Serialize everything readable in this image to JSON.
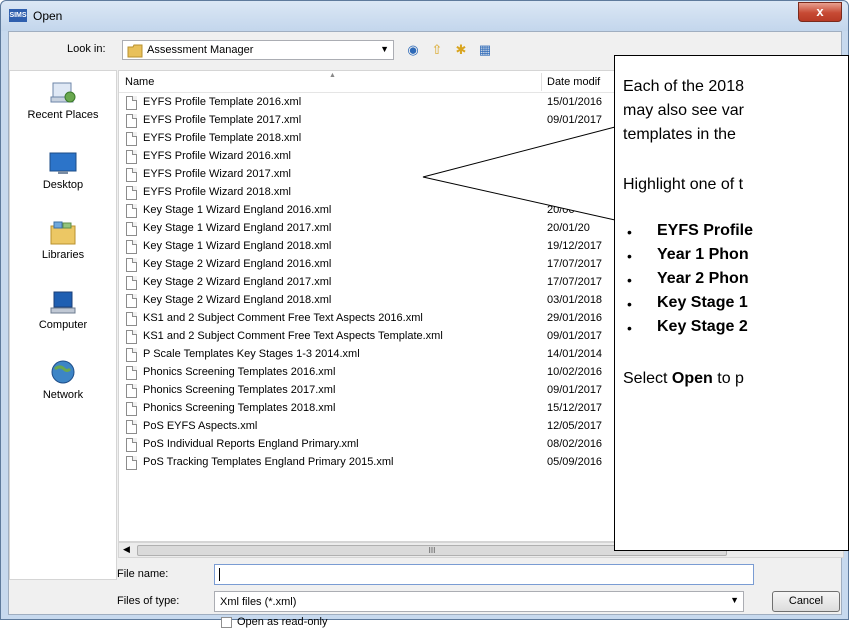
{
  "window": {
    "title": "Open",
    "app_badge": "SIMS",
    "close_glyph": "x"
  },
  "toolbar": {
    "look_in_label": "Look in:",
    "look_in_value": "Assessment Manager"
  },
  "places": [
    {
      "label": "Recent Places"
    },
    {
      "label": "Desktop"
    },
    {
      "label": "Libraries"
    },
    {
      "label": "Computer"
    },
    {
      "label": "Network"
    }
  ],
  "list": {
    "headers": {
      "name": "Name",
      "date": "Date modif"
    },
    "files": [
      {
        "name": "EYFS Profile Template 2016.xml",
        "date": "15/01/2016"
      },
      {
        "name": "EYFS Profile Template 2017.xml",
        "date": "09/01/2017"
      },
      {
        "name": "EYFS Profile Template 2018.xml",
        "date": ""
      },
      {
        "name": "EYFS Profile Wizard 2016.xml",
        "date": ""
      },
      {
        "name": "EYFS Profile Wizard 2017.xml",
        "date": ""
      },
      {
        "name": "EYFS Profile Wizard 2018.xml",
        "date": "18"
      },
      {
        "name": "Key Stage 1 Wizard England 2016.xml",
        "date": "20/06"
      },
      {
        "name": "Key Stage 1 Wizard England 2017.xml",
        "date": "20/01/20"
      },
      {
        "name": "Key Stage 1 Wizard England 2018.xml",
        "date": "19/12/2017"
      },
      {
        "name": "Key Stage 2 Wizard England 2016.xml",
        "date": "17/07/2017"
      },
      {
        "name": "Key Stage 2 Wizard England 2017.xml",
        "date": "17/07/2017"
      },
      {
        "name": "Key Stage 2 Wizard England 2018.xml",
        "date": "03/01/2018"
      },
      {
        "name": "KS1 and 2 Subject Comment Free Text Aspects 2016.xml",
        "date": "29/01/2016"
      },
      {
        "name": "KS1 and 2 Subject Comment Free Text Aspects Template.xml",
        "date": "09/01/2017"
      },
      {
        "name": "P Scale Templates Key Stages 1-3 2014.xml",
        "date": "14/01/2014"
      },
      {
        "name": "Phonics Screening Templates 2016.xml",
        "date": "10/02/2016"
      },
      {
        "name": "Phonics Screening Templates 2017.xml",
        "date": "09/01/2017"
      },
      {
        "name": "Phonics Screening Templates 2018.xml",
        "date": "15/12/2017"
      },
      {
        "name": "PoS EYFS Aspects.xml",
        "date": "12/05/2017"
      },
      {
        "name": "PoS Individual Reports England Primary.xml",
        "date": "08/02/2016"
      },
      {
        "name": "PoS Tracking Templates England Primary 2015.xml",
        "date": "05/09/2016"
      }
    ],
    "scroll_grip": "III"
  },
  "form": {
    "file_name_label": "File name:",
    "file_name_value": "",
    "files_of_type_label": "Files of type:",
    "files_of_type_value": "Xml files (*.xml)",
    "cancel_label": "Cancel",
    "read_only_label": "Open as read-only"
  },
  "callout": {
    "line1": "Each of the 2018",
    "line2": "may also see var",
    "line3": "templates in the",
    "highlight": "Highlight one of t",
    "bullets": [
      "EYFS Profile",
      "Year 1 Phon",
      "Year 2 Phon",
      "Key Stage 1",
      "Key Stage 2"
    ],
    "bullet_glyph": "•",
    "select_prefix": "Select ",
    "select_bold": "Open",
    "select_suffix": " to p"
  }
}
